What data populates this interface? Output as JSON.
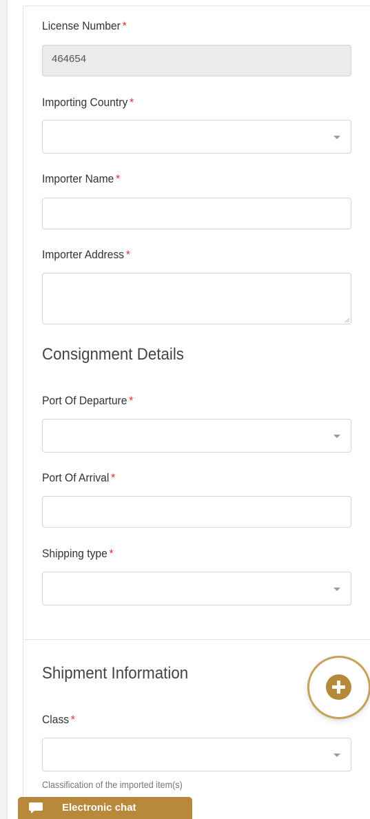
{
  "form": {
    "license_number": {
      "label": "License Number",
      "required_mark": "*",
      "value": "464654"
    },
    "importing_country": {
      "label": "Importing Country",
      "required_mark": "*",
      "value": ""
    },
    "importer_name": {
      "label": "Importer Name",
      "required_mark": "*",
      "value": ""
    },
    "importer_address": {
      "label": "Importer Address",
      "required_mark": "*",
      "value": ""
    }
  },
  "consignment": {
    "heading": "Consignment Details",
    "port_of_departure": {
      "label": "Port Of Departure",
      "required_mark": "*",
      "value": ""
    },
    "port_of_arrival": {
      "label": "Port Of Arrival",
      "required_mark": "*",
      "value": ""
    },
    "shipping_type": {
      "label": "Shipping type",
      "required_mark": "*",
      "value": ""
    }
  },
  "shipment": {
    "heading": "Shipment Information",
    "class": {
      "label": "Class",
      "required_mark": "*",
      "value": "",
      "helper": "Classification of the imported item(s)"
    }
  },
  "chat": {
    "label": "Electronic chat"
  },
  "icons": {
    "add": "plus-circle-icon",
    "dropdown": "chevron-down-icon",
    "chat": "chat-bubble-icon"
  },
  "colors": {
    "required": "#e4312b",
    "accent": "#b8893a",
    "disabled_bg": "#ebebeb"
  }
}
